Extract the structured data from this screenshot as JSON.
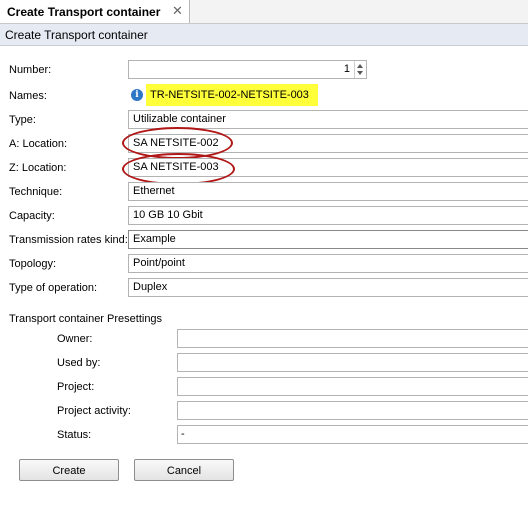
{
  "tab": {
    "title": "Create Transport container",
    "close_glyph": "✕"
  },
  "header": {
    "title": "Create Transport container"
  },
  "form": {
    "number": {
      "label": "Number:",
      "value": "1"
    },
    "names": {
      "label": "Names:",
      "value": "TR-NETSITE-002-NETSITE-003"
    },
    "type": {
      "label": "Type:",
      "value": "Utilizable container"
    },
    "a_location": {
      "label": "A: Location:",
      "value": "SA NETSITE-002"
    },
    "z_location": {
      "label": "Z: Location:",
      "value": "SA NETSITE-003"
    },
    "technique": {
      "label": "Technique:",
      "value": "Ethernet"
    },
    "capacity": {
      "label": "Capacity:",
      "value": "10 GB 10 Gbit"
    },
    "transmission_rates_kind": {
      "label": "Transmission rates kind:",
      "value": "Example"
    },
    "topology": {
      "label": "Topology:",
      "value": "Point/point"
    },
    "type_of_operation": {
      "label": "Type of operation:",
      "value": "Duplex"
    }
  },
  "presettings": {
    "title": "Transport container Presettings",
    "owner": {
      "label": "Owner:",
      "value": ""
    },
    "used_by": {
      "label": "Used by:",
      "value": ""
    },
    "project": {
      "label": "Project:",
      "value": ""
    },
    "project_activity": {
      "label": "Project activity:",
      "value": ""
    },
    "status": {
      "label": "Status:",
      "value": "-"
    }
  },
  "buttons": {
    "create": "Create",
    "cancel": "Cancel"
  },
  "colors": {
    "highlight": "#ffff3a",
    "annotation_ring": "#b01818",
    "info_icon": "#2e77c7",
    "header_background": "#e6ebf3"
  },
  "icons": {
    "info": "info-icon",
    "close": "close-icon",
    "spinner": "spinner-icon"
  }
}
